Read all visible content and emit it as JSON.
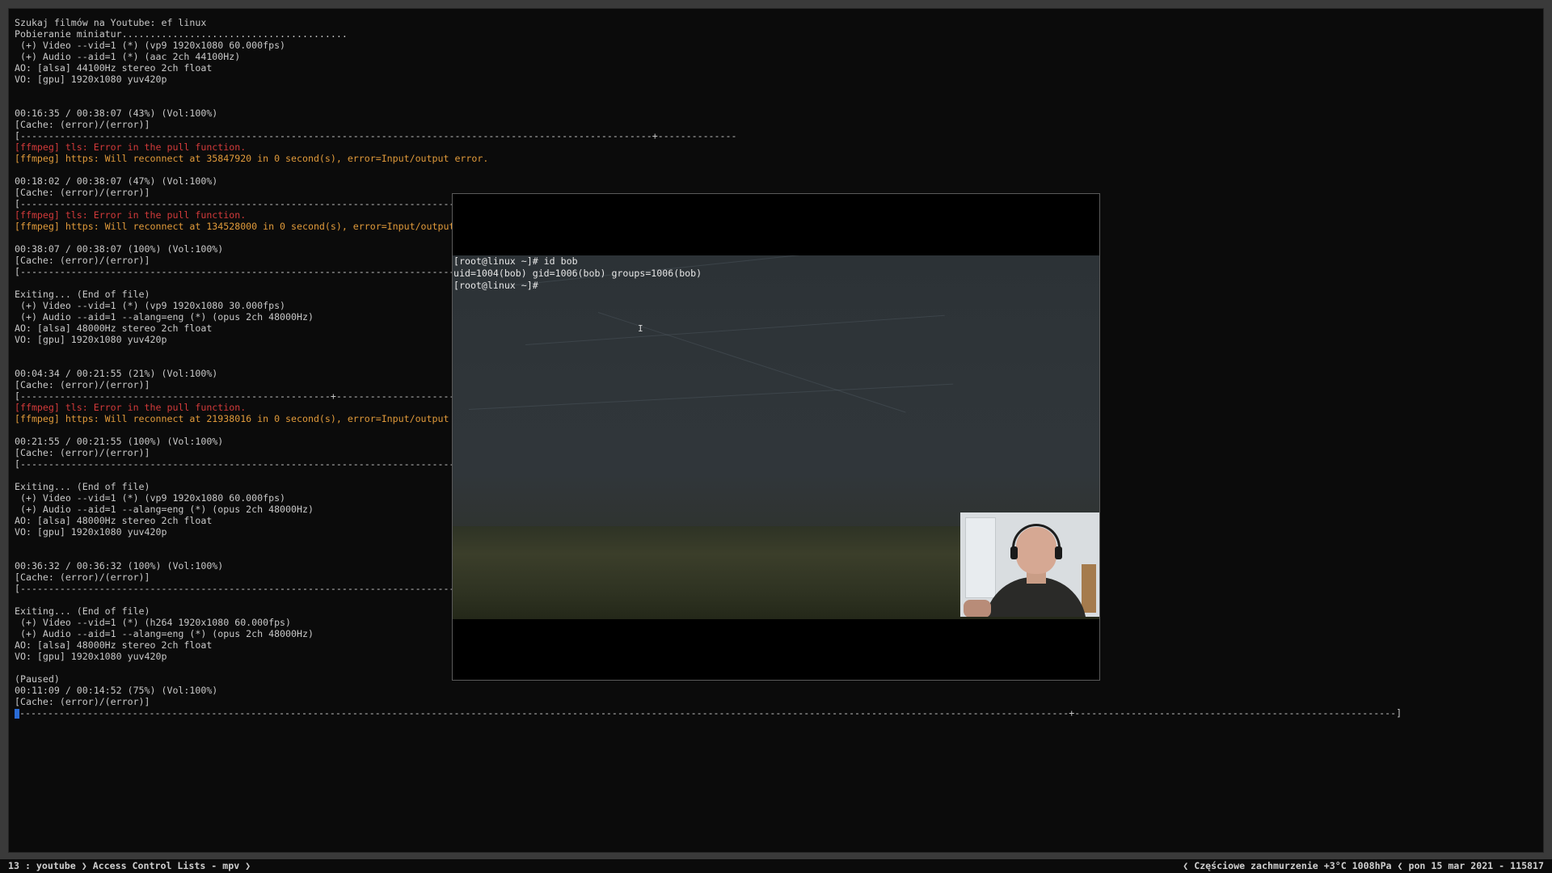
{
  "terminal": {
    "lines": [
      {
        "text": "Szukaj filmów na Youtube: ef linux",
        "style": "normal"
      },
      {
        "text": "Pobieranie miniatur........................................",
        "style": "normal"
      },
      {
        "text": " (+) Video --vid=1 (*) (vp9 1920x1080 60.000fps)",
        "style": "normal"
      },
      {
        "text": " (+) Audio --aid=1 (*) (aac 2ch 44100Hz)",
        "style": "normal"
      },
      {
        "text": "AO: [alsa] 44100Hz stereo 2ch float",
        "style": "normal"
      },
      {
        "text": "VO: [gpu] 1920x1080 yuv420p",
        "style": "normal"
      },
      {
        "text": "",
        "style": "normal"
      },
      {
        "text": "",
        "style": "normal"
      },
      {
        "text": "00:16:35 / 00:38:07 (43%) (Vol:100%)",
        "style": "normal"
      },
      {
        "text": "[Cache: (error)/(error)]",
        "style": "normal"
      },
      {
        "text": "[----------------------------------------------------------------------------------------------------------------+--------------",
        "style": "normal"
      },
      {
        "text": "[ffmpeg] tls: Error in the pull function.",
        "style": "err"
      },
      {
        "text": "[ffmpeg] https: Will reconnect at 35847920 in 0 second(s), error=Input/output error.",
        "style": "warn"
      },
      {
        "text": "",
        "style": "normal"
      },
      {
        "text": "00:18:02 / 00:38:07 (47%) (Vol:100%)",
        "style": "normal"
      },
      {
        "text": "[Cache: (error)/(error)]",
        "style": "normal"
      },
      {
        "text": "[------------------------------------------------------------------------------",
        "style": "normal"
      },
      {
        "text": "[ffmpeg] tls: Error in the pull function.",
        "style": "err"
      },
      {
        "text": "[ffmpeg] https: Will reconnect at 134528000 in 0 second(s), error=Input/output",
        "style": "warn"
      },
      {
        "text": "",
        "style": "normal"
      },
      {
        "text": "00:38:07 / 00:38:07 (100%) (Vol:100%)",
        "style": "normal"
      },
      {
        "text": "[Cache: (error)/(error)]",
        "style": "normal"
      },
      {
        "text": "[------------------------------------------------------------------------------",
        "style": "normal"
      },
      {
        "text": "",
        "style": "normal"
      },
      {
        "text": "Exiting... (End of file)",
        "style": "normal"
      },
      {
        "text": " (+) Video --vid=1 (*) (vp9 1920x1080 30.000fps)",
        "style": "normal"
      },
      {
        "text": " (+) Audio --aid=1 --alang=eng (*) (opus 2ch 48000Hz)",
        "style": "normal"
      },
      {
        "text": "AO: [alsa] 48000Hz stereo 2ch float",
        "style": "normal"
      },
      {
        "text": "VO: [gpu] 1920x1080 yuv420p",
        "style": "normal"
      },
      {
        "text": "",
        "style": "normal"
      },
      {
        "text": "",
        "style": "normal"
      },
      {
        "text": "00:04:34 / 00:21:55 (21%) (Vol:100%)",
        "style": "normal"
      },
      {
        "text": "[Cache: (error)/(error)]",
        "style": "normal"
      },
      {
        "text": "[-------------------------------------------------------+----------------------",
        "style": "normal"
      },
      {
        "text": "[ffmpeg] tls: Error in the pull function.",
        "style": "err"
      },
      {
        "text": "[ffmpeg] https: Will reconnect at 21938016 in 0 second(s), error=Input/output",
        "style": "warn"
      },
      {
        "text": "",
        "style": "normal"
      },
      {
        "text": "00:21:55 / 00:21:55 (100%) (Vol:100%)",
        "style": "normal"
      },
      {
        "text": "[Cache: (error)/(error)]",
        "style": "normal"
      },
      {
        "text": "[------------------------------------------------------------------------------",
        "style": "normal"
      },
      {
        "text": "",
        "style": "normal"
      },
      {
        "text": "Exiting... (End of file)",
        "style": "normal"
      },
      {
        "text": " (+) Video --vid=1 (*) (vp9 1920x1080 60.000fps)",
        "style": "normal"
      },
      {
        "text": " (+) Audio --aid=1 --alang=eng (*) (opus 2ch 48000Hz)",
        "style": "normal"
      },
      {
        "text": "AO: [alsa] 48000Hz stereo 2ch float",
        "style": "normal"
      },
      {
        "text": "VO: [gpu] 1920x1080 yuv420p",
        "style": "normal"
      },
      {
        "text": "",
        "style": "normal"
      },
      {
        "text": "",
        "style": "normal"
      },
      {
        "text": "00:36:32 / 00:36:32 (100%) (Vol:100%)",
        "style": "normal"
      },
      {
        "text": "[Cache: (error)/(error)]",
        "style": "normal"
      },
      {
        "text": "[------------------------------------------------------------------------------",
        "style": "normal"
      },
      {
        "text": "",
        "style": "normal"
      },
      {
        "text": "Exiting... (End of file)",
        "style": "normal"
      },
      {
        "text": " (+) Video --vid=1 (*) (h264 1920x1080 60.000fps)",
        "style": "normal"
      },
      {
        "text": " (+) Audio --aid=1 --alang=eng (*) (opus 2ch 48000Hz)",
        "style": "normal"
      },
      {
        "text": "AO: [alsa] 48000Hz stereo 2ch float",
        "style": "normal"
      },
      {
        "text": "VO: [gpu] 1920x1080 yuv420p",
        "style": "normal"
      },
      {
        "text": "",
        "style": "normal"
      },
      {
        "text": "(Paused)",
        "style": "normal"
      },
      {
        "text": "00:11:09 / 00:14:52 (75%) (Vol:100%)",
        "style": "normal"
      },
      {
        "text": "[Cache: (error)/(error)]",
        "style": "normal"
      }
    ],
    "progress_line": "------------------------------------------------------------------------------------------------------------------------------------------------------------------------------------------+---------------------------------------------------------]",
    "progress_fraction": 0.75
  },
  "video": {
    "terminal_lines": [
      "[root@linux ~]# id bob",
      "uid=1004(bob) gid=1006(bob) groups=1006(bob)",
      "[root@linux ~]#"
    ],
    "text_cursor_glyph": "I"
  },
  "statusbar": {
    "left": "13 : youtube ❯ Access Control Lists - mpv ❯",
    "right": "❮ Częściowe zachmurzenie +3°C 1008hPa ❮ pon 15 mar 2021 - 115817"
  },
  "colors": {
    "terminal_bg": "#0b0b0b",
    "text": "#c8c8c8",
    "error": "#d23a3a",
    "warning": "#e09a3a",
    "cursor": "#2a6bd6"
  },
  "icons": {
    "cursor": "text-cursor-icon"
  }
}
